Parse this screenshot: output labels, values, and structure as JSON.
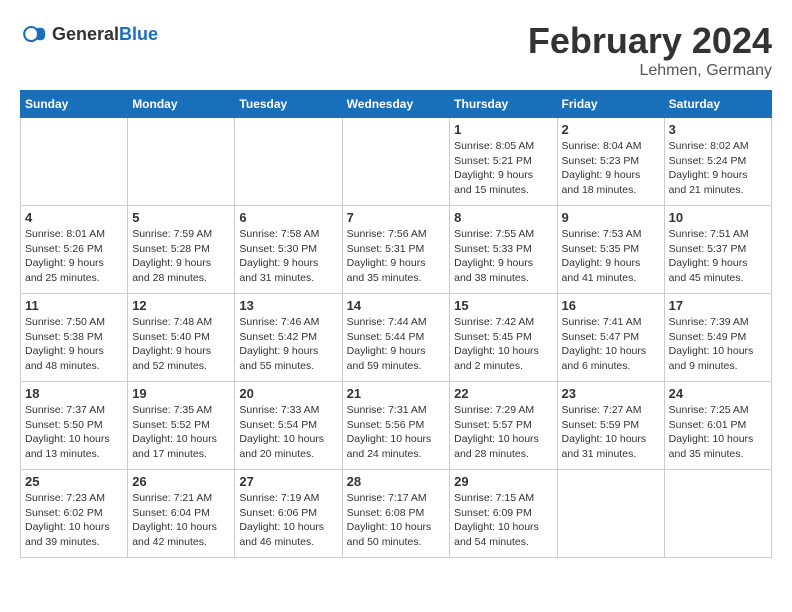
{
  "header": {
    "logo_general": "General",
    "logo_blue": "Blue",
    "month_year": "February 2024",
    "location": "Lehmen, Germany"
  },
  "weekdays": [
    "Sunday",
    "Monday",
    "Tuesday",
    "Wednesday",
    "Thursday",
    "Friday",
    "Saturday"
  ],
  "weeks": [
    [
      {
        "day": "",
        "info": ""
      },
      {
        "day": "",
        "info": ""
      },
      {
        "day": "",
        "info": ""
      },
      {
        "day": "",
        "info": ""
      },
      {
        "day": "1",
        "info": "Sunrise: 8:05 AM\nSunset: 5:21 PM\nDaylight: 9 hours\nand 15 minutes."
      },
      {
        "day": "2",
        "info": "Sunrise: 8:04 AM\nSunset: 5:23 PM\nDaylight: 9 hours\nand 18 minutes."
      },
      {
        "day": "3",
        "info": "Sunrise: 8:02 AM\nSunset: 5:24 PM\nDaylight: 9 hours\nand 21 minutes."
      }
    ],
    [
      {
        "day": "4",
        "info": "Sunrise: 8:01 AM\nSunset: 5:26 PM\nDaylight: 9 hours\nand 25 minutes."
      },
      {
        "day": "5",
        "info": "Sunrise: 7:59 AM\nSunset: 5:28 PM\nDaylight: 9 hours\nand 28 minutes."
      },
      {
        "day": "6",
        "info": "Sunrise: 7:58 AM\nSunset: 5:30 PM\nDaylight: 9 hours\nand 31 minutes."
      },
      {
        "day": "7",
        "info": "Sunrise: 7:56 AM\nSunset: 5:31 PM\nDaylight: 9 hours\nand 35 minutes."
      },
      {
        "day": "8",
        "info": "Sunrise: 7:55 AM\nSunset: 5:33 PM\nDaylight: 9 hours\nand 38 minutes."
      },
      {
        "day": "9",
        "info": "Sunrise: 7:53 AM\nSunset: 5:35 PM\nDaylight: 9 hours\nand 41 minutes."
      },
      {
        "day": "10",
        "info": "Sunrise: 7:51 AM\nSunset: 5:37 PM\nDaylight: 9 hours\nand 45 minutes."
      }
    ],
    [
      {
        "day": "11",
        "info": "Sunrise: 7:50 AM\nSunset: 5:38 PM\nDaylight: 9 hours\nand 48 minutes."
      },
      {
        "day": "12",
        "info": "Sunrise: 7:48 AM\nSunset: 5:40 PM\nDaylight: 9 hours\nand 52 minutes."
      },
      {
        "day": "13",
        "info": "Sunrise: 7:46 AM\nSunset: 5:42 PM\nDaylight: 9 hours\nand 55 minutes."
      },
      {
        "day": "14",
        "info": "Sunrise: 7:44 AM\nSunset: 5:44 PM\nDaylight: 9 hours\nand 59 minutes."
      },
      {
        "day": "15",
        "info": "Sunrise: 7:42 AM\nSunset: 5:45 PM\nDaylight: 10 hours\nand 2 minutes."
      },
      {
        "day": "16",
        "info": "Sunrise: 7:41 AM\nSunset: 5:47 PM\nDaylight: 10 hours\nand 6 minutes."
      },
      {
        "day": "17",
        "info": "Sunrise: 7:39 AM\nSunset: 5:49 PM\nDaylight: 10 hours\nand 9 minutes."
      }
    ],
    [
      {
        "day": "18",
        "info": "Sunrise: 7:37 AM\nSunset: 5:50 PM\nDaylight: 10 hours\nand 13 minutes."
      },
      {
        "day": "19",
        "info": "Sunrise: 7:35 AM\nSunset: 5:52 PM\nDaylight: 10 hours\nand 17 minutes."
      },
      {
        "day": "20",
        "info": "Sunrise: 7:33 AM\nSunset: 5:54 PM\nDaylight: 10 hours\nand 20 minutes."
      },
      {
        "day": "21",
        "info": "Sunrise: 7:31 AM\nSunset: 5:56 PM\nDaylight: 10 hours\nand 24 minutes."
      },
      {
        "day": "22",
        "info": "Sunrise: 7:29 AM\nSunset: 5:57 PM\nDaylight: 10 hours\nand 28 minutes."
      },
      {
        "day": "23",
        "info": "Sunrise: 7:27 AM\nSunset: 5:59 PM\nDaylight: 10 hours\nand 31 minutes."
      },
      {
        "day": "24",
        "info": "Sunrise: 7:25 AM\nSunset: 6:01 PM\nDaylight: 10 hours\nand 35 minutes."
      }
    ],
    [
      {
        "day": "25",
        "info": "Sunrise: 7:23 AM\nSunset: 6:02 PM\nDaylight: 10 hours\nand 39 minutes."
      },
      {
        "day": "26",
        "info": "Sunrise: 7:21 AM\nSunset: 6:04 PM\nDaylight: 10 hours\nand 42 minutes."
      },
      {
        "day": "27",
        "info": "Sunrise: 7:19 AM\nSunset: 6:06 PM\nDaylight: 10 hours\nand 46 minutes."
      },
      {
        "day": "28",
        "info": "Sunrise: 7:17 AM\nSunset: 6:08 PM\nDaylight: 10 hours\nand 50 minutes."
      },
      {
        "day": "29",
        "info": "Sunrise: 7:15 AM\nSunset: 6:09 PM\nDaylight: 10 hours\nand 54 minutes."
      },
      {
        "day": "",
        "info": ""
      },
      {
        "day": "",
        "info": ""
      }
    ]
  ]
}
